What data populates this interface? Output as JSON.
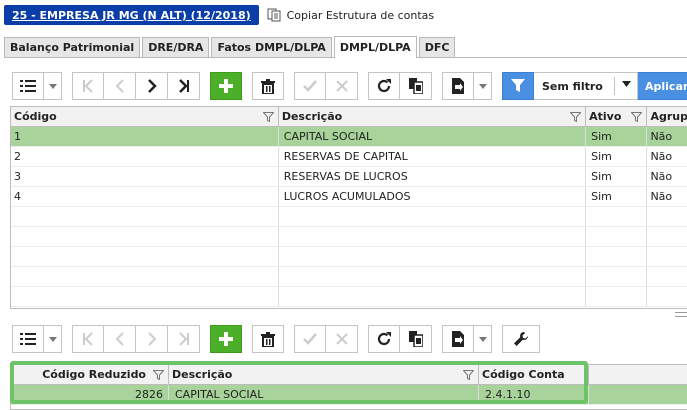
{
  "header": {
    "company_label": "25 - EMPRESA JR MG (N ALT) (12/2018)",
    "copy_label": "Copiar Estrutura de contas"
  },
  "tabs": [
    {
      "label": "Balanço Patrimonial",
      "active": false
    },
    {
      "label": "DRE/DRA",
      "active": false
    },
    {
      "label": "Fatos DMPL/DLPA",
      "active": false
    },
    {
      "label": "DMPL/DLPA",
      "active": true
    },
    {
      "label": "DFC",
      "active": false
    }
  ],
  "filter": {
    "selected": "Sem filtro",
    "apply_label": "Aplicar"
  },
  "grid_top": {
    "columns": [
      "Código",
      "Descrição",
      "Ativo",
      "Agrup"
    ],
    "rows": [
      {
        "code": "1",
        "desc": "CAPITAL SOCIAL",
        "active": "Sim",
        "group": "Não",
        "selected": true
      },
      {
        "code": "2",
        "desc": "RESERVAS DE CAPITAL",
        "active": "Sim",
        "group": "Não",
        "selected": false
      },
      {
        "code": "3",
        "desc": "RESERVAS DE LUCROS",
        "active": "Sim",
        "group": "Não",
        "selected": false
      },
      {
        "code": "4",
        "desc": "LUCROS ACUMULADOS",
        "active": "Sim",
        "group": "Não",
        "selected": false
      }
    ]
  },
  "grid_bottom": {
    "columns": [
      "Código Reduzido",
      "Descrição",
      "Código Conta"
    ],
    "rows": [
      {
        "reduced": "2826",
        "desc": "CAPITAL SOCIAL",
        "account": "2.4.1.10"
      }
    ]
  },
  "colors": {
    "brand": "#0b3ea8",
    "accent": "#4a90e2",
    "add": "#4caf2a",
    "selected_row": "#a8d39a",
    "highlight": "#6dc468"
  }
}
